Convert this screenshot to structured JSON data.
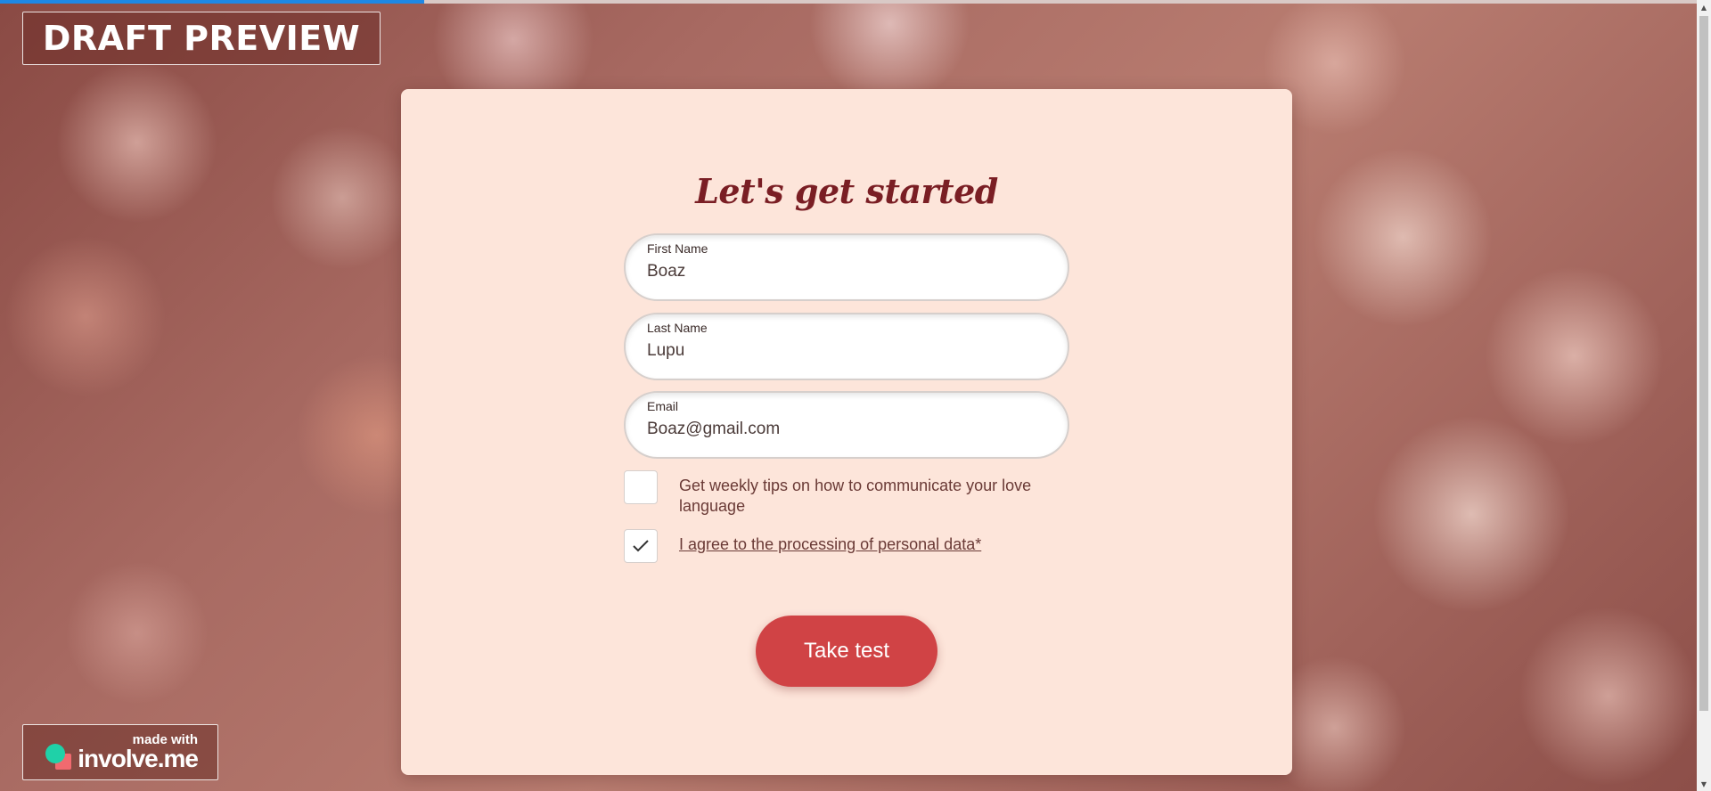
{
  "page": {
    "progress_percent": 25,
    "draft_badge": "DRAFT PREVIEW"
  },
  "form": {
    "title": "Let's get started",
    "fields": [
      {
        "label": "First Name",
        "value": "Boaz"
      },
      {
        "label": "Last Name",
        "value": "Lupu"
      },
      {
        "label": "Email",
        "value": "Boaz@gmail.com"
      }
    ],
    "checkboxes": [
      {
        "label": "Get weekly tips on how to communicate your love language",
        "checked": false
      },
      {
        "label": "I agree to the processing of personal data*",
        "checked": true
      }
    ],
    "submit_label": "Take test"
  },
  "footer": {
    "made_with": "made with",
    "brand": "involve.me"
  },
  "colors": {
    "accent": "#d04345",
    "title": "#7a1e24",
    "card_bg": "#fde5da",
    "progress": "#1e88e5"
  }
}
